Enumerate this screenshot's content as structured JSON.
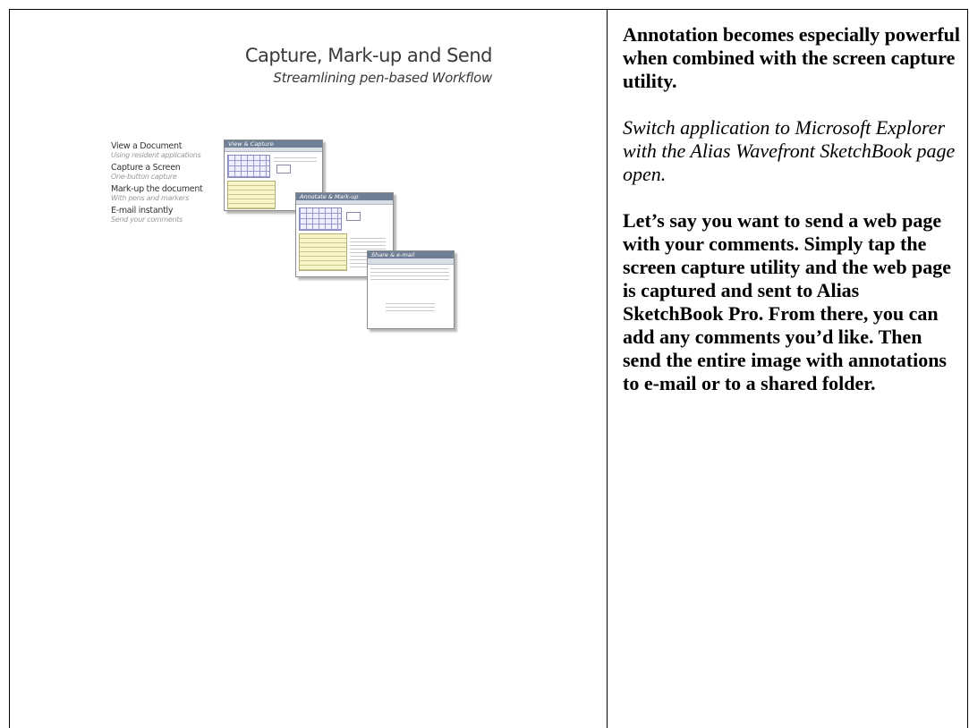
{
  "slide": {
    "title": "Capture, Mark-up and Send",
    "subtitle": "Streamlining pen-based Workflow",
    "steps": [
      {
        "title": "View a Document",
        "subtitle": "Using resident applications"
      },
      {
        "title": "Capture a Screen",
        "subtitle": "One-button capture"
      },
      {
        "title": "Mark-up the document",
        "subtitle": "With pens and markers"
      },
      {
        "title": "E-mail instantly",
        "subtitle": "Send your comments"
      }
    ],
    "screenshots": [
      {
        "title": "View & Capture"
      },
      {
        "title": "Annotate & Mark-up"
      },
      {
        "title": "Share & e-mail"
      }
    ]
  },
  "notes": {
    "para1": "Annotation becomes especially powerful when combined with the screen capture utility.",
    "para2": "Switch application to Microsoft Explorer with the Alias Wavefront SketchBook page open.",
    "para3": "Let’s say you want to send a web page with your comments. Simply tap the screen capture utility and the web page is captured and sent to Alias SketchBook Pro. From there, you can add any comments you’d like. Then send the entire image with annotations to e-mail or to a shared folder."
  },
  "colors": {
    "titlebar": "#6f7f95",
    "slide_text": "#3a3a3a",
    "step_subtitle": "#9a9a9a"
  }
}
